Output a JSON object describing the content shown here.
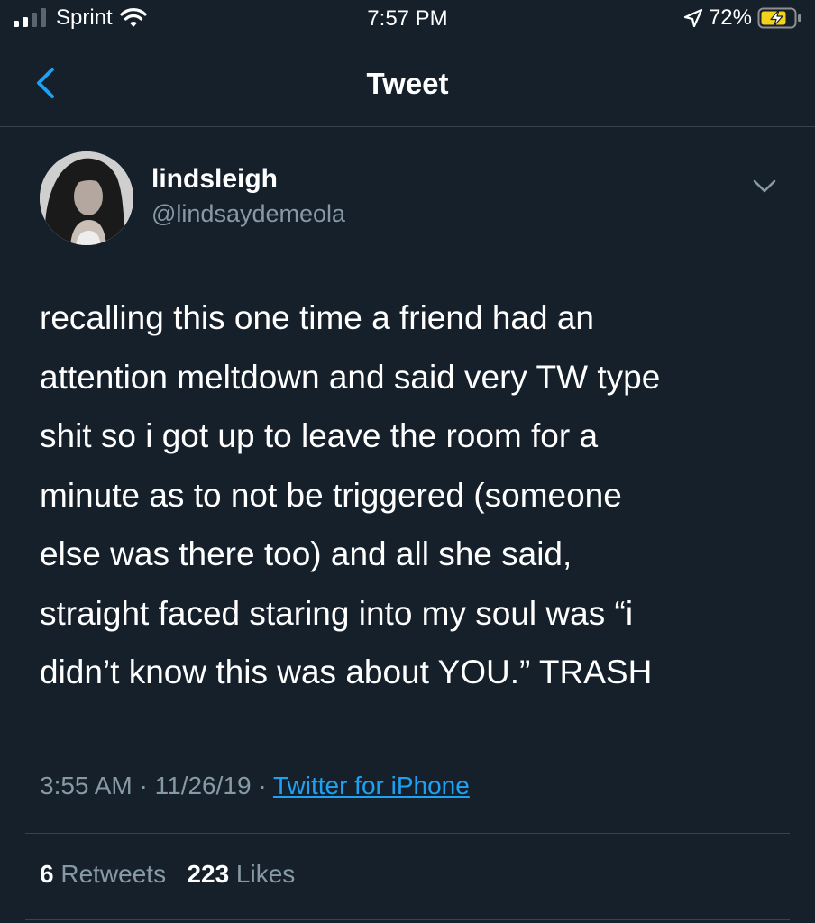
{
  "status_bar": {
    "carrier": "Sprint",
    "time": "7:57 PM",
    "battery": "72%"
  },
  "nav": {
    "title": "Tweet"
  },
  "tweet": {
    "display_name": "lindsleigh",
    "handle": "@lindsaydemeola",
    "text": "recalling this one time a friend had an\nattention meltdown and said very TW type\nshit so i got up to leave the room for a\nminute as to not be triggered (someone\nelse was there too) and all she said,\nstraight faced staring into my soul was “i\ndidn’t know this was about YOU.” TRASH",
    "time": "3:55 AM",
    "date": "11/26/19",
    "separator": "·",
    "source": "Twitter for iPhone",
    "retweet_count": "6",
    "retweet_label": "Retweets",
    "like_count": "223",
    "like_label": "Likes"
  },
  "colors": {
    "background": "#15202b",
    "accent": "#1da1f2",
    "secondary_text": "#8899a6",
    "divider": "#38444d"
  }
}
